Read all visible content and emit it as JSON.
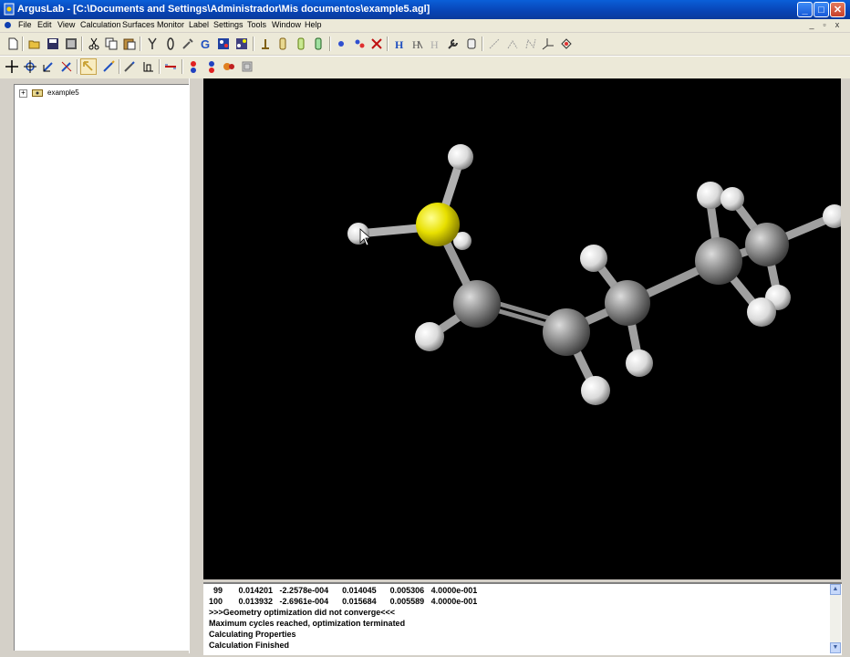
{
  "window": {
    "title": "ArgusLab - [C:\\Documents and Settings\\Administrador\\Mis documentos\\example5.agl]",
    "controls": {
      "minimize": "_",
      "maximize": "□",
      "close": "✕"
    }
  },
  "menu": {
    "items": [
      "File",
      "Edit",
      "View",
      "Calculation",
      "Surfaces",
      "Monitor",
      "Label",
      "Settings",
      "Tools",
      "Window",
      "Help"
    ],
    "mdi_controls": [
      "_",
      "▫",
      "x"
    ]
  },
  "toolbar1": {
    "icons": [
      "new-icon",
      "open-icon",
      "save-icon",
      "print-icon",
      "cut-icon",
      "copy-icon",
      "paste-icon",
      "build-icon",
      "bond-icon",
      "tool-icon",
      "g-icon",
      "molecule-icon",
      "molecule-icon",
      "marker-icon",
      "marker-icon",
      "marker-icon",
      "marker-icon",
      "atom-icon",
      "atom-icon",
      "delete-icon",
      "h-icon",
      "h-icon",
      "h-icon",
      "wrench-icon",
      "clean-icon",
      "measure-icon",
      "measure-icon",
      "measure-icon",
      "axis-icon",
      "network-icon"
    ]
  },
  "toolbar2": {
    "icons": [
      "move-icon",
      "rotate-icon",
      "translate-icon",
      "zoom-icon",
      "select-icon",
      "pencil-icon",
      "draw-icon",
      "fragment-icon",
      "bond-icon",
      "atom-red-icon",
      "atom-blue-icon",
      "atom-orange-icon",
      "view-icon"
    ]
  },
  "tree": {
    "root": {
      "expander": "+",
      "label": "example5"
    }
  },
  "output": {
    "lines": [
      "  99       0.014201   -2.2578e-004      0.014045      0.005306   4.0000e-001",
      "100       0.013932   -2.6961e-004      0.015684      0.005589   4.0000e-001",
      ">>>Geometry optimization did not converge<<<",
      "Maximum cycles reached, optimization terminated",
      "Calculating Properties",
      "Calculation Finished"
    ],
    "scroll_up": "▲",
    "scroll_down": "▼"
  },
  "colors": {
    "titlebar": "#0843b4",
    "background": "#d4d0c8",
    "viewport": "#000000",
    "carbon": "#808080",
    "hydrogen": "#e8e8e8",
    "sulfur": "#e6e000"
  }
}
